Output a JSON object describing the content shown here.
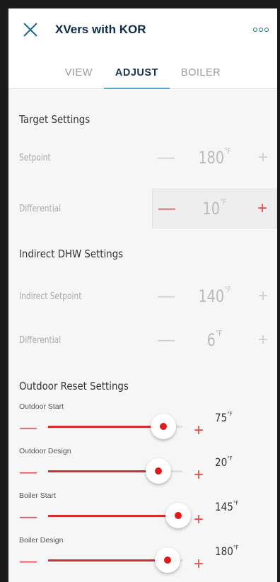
{
  "app": {
    "title": "XVers with KOR",
    "close_icon": "close-icon",
    "more_icon": "more-horizontal-icon"
  },
  "tabs": [
    {
      "label": "VIEW",
      "active": false
    },
    {
      "label": "ADJUST",
      "active": true
    },
    {
      "label": "BOILER",
      "active": false
    }
  ],
  "target": {
    "title": "Target Settings",
    "setpoint": {
      "label": "Setpoint",
      "value": "180",
      "unit": "°F",
      "minus": "—",
      "plus": "+"
    },
    "differential": {
      "label": "Differential",
      "value": "10",
      "unit": "°F",
      "minus": "—",
      "plus": "+"
    }
  },
  "dhw": {
    "title": "Indirect DHW Settings",
    "setpoint": {
      "label": "Indirect Setpoint",
      "value": "140",
      "unit": "°F",
      "minus": "—",
      "plus": "+"
    },
    "differential": {
      "label": "Differential",
      "value": "6",
      "unit": "°F",
      "minus": "—",
      "plus": "+"
    }
  },
  "outdoor": {
    "title": "Outdoor Reset Settings",
    "sliders": [
      {
        "label": "Outdoor Start",
        "value": "75",
        "unit": "°F",
        "minus": "—",
        "plus": "+",
        "fraction": 0.86
      },
      {
        "label": "Outdoor Design",
        "value": "20",
        "unit": "°F",
        "minus": "—",
        "plus": "+",
        "fraction": 0.82
      },
      {
        "label": "Boiler Start",
        "value": "145",
        "unit": "°F",
        "minus": "—",
        "plus": "+",
        "fraction": 0.97
      },
      {
        "label": "Boiler Design",
        "value": "180",
        "unit": "°F",
        "minus": "—",
        "plus": "+",
        "fraction": 0.89
      }
    ]
  },
  "colors": {
    "accent": "#5aa6c8",
    "title": "#0f2a47",
    "red": "#e01a1a"
  }
}
